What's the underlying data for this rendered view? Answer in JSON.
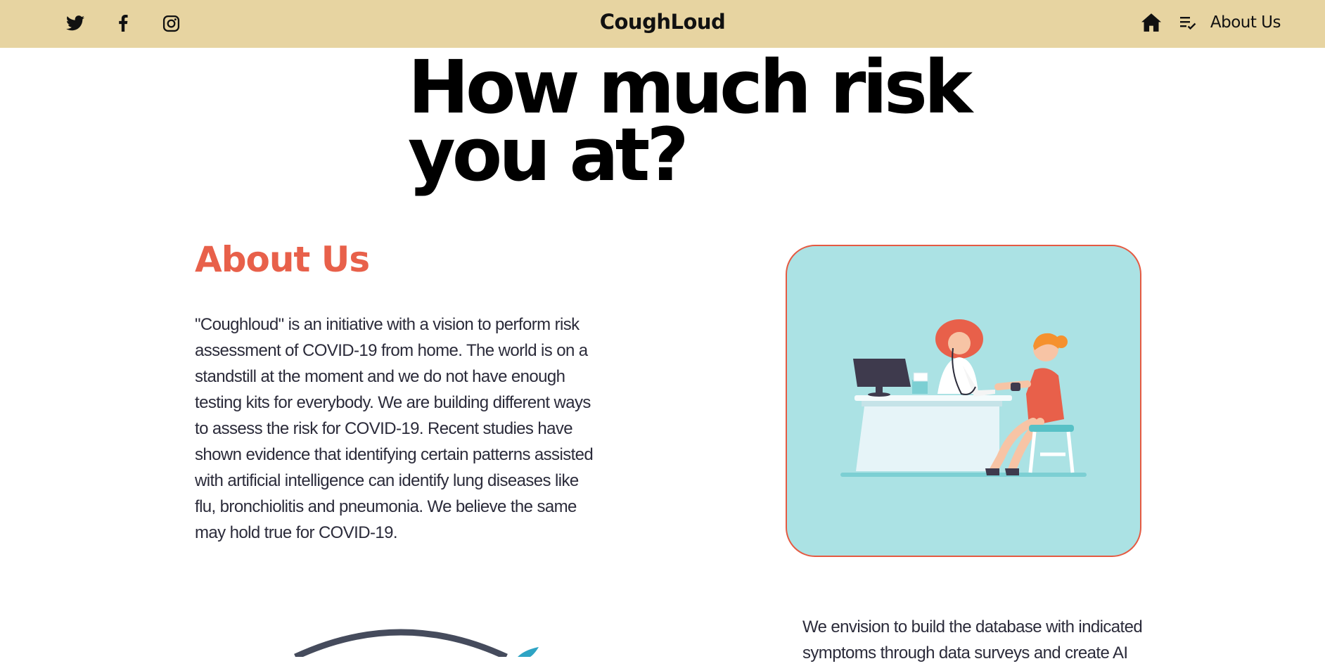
{
  "brand": "CoughLoud",
  "nav": {
    "social": [
      "twitter-icon",
      "facebook-icon",
      "instagram-icon"
    ],
    "home_icon": "home-icon",
    "list_icon": "playlist-check-icon",
    "about_label": "About Us"
  },
  "hero": {
    "line1": "How much risk",
    "line2": "you at?"
  },
  "about": {
    "heading": "About Us",
    "body": "\"Coughloud\" is an initiative with a vision to perform risk assessment of COVID-19 from home. The world is on a standstill at the moment and we do not have enough testing kits for everybody. We are building different ways to assess the risk for COVID-19. Recent studies have shown evidence that identifying certain patterns assisted with artificial intelligence can identify lung diseases like flu, bronchiolitis and pneumonia. We believe the same may hold true for COVID-19."
  },
  "vision": {
    "body": "We envision to build the database with indicated symptoms through data surveys and create AI"
  },
  "colors": {
    "topbar": "#e7d4a1",
    "accent": "#e8604a",
    "card_bg": "#abe2e4",
    "card_border": "#e55a42"
  }
}
